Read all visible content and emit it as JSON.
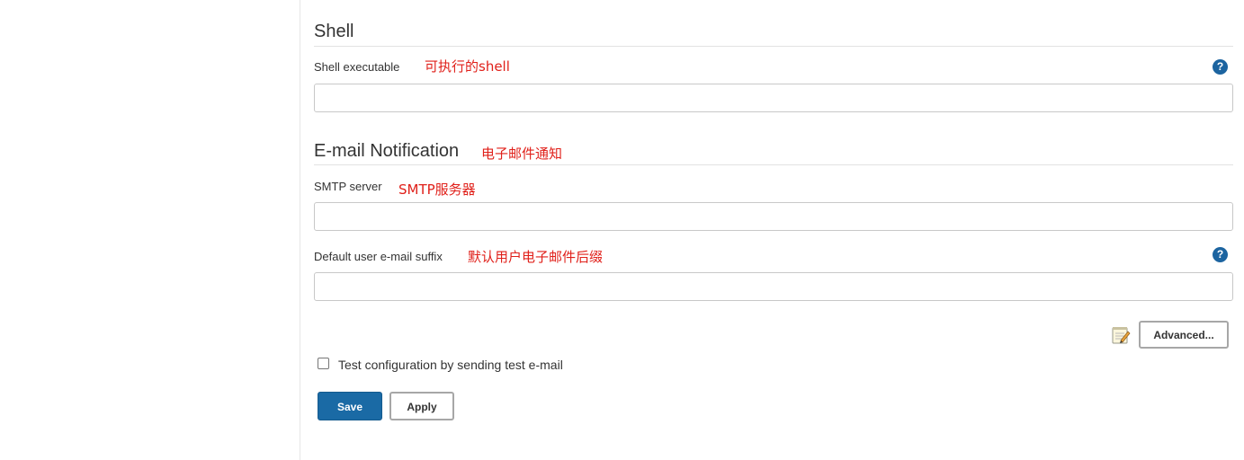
{
  "shell": {
    "title": "Shell",
    "executable_label": "Shell executable",
    "executable_annotation": "可执行的shell",
    "executable_value": ""
  },
  "email": {
    "title": "E-mail Notification",
    "title_annotation": "电子邮件通知",
    "smtp_label": "SMTP server",
    "smtp_annotation": "SMTP服务器",
    "smtp_value": "",
    "suffix_label": "Default user e-mail suffix",
    "suffix_annotation": "默认用户电子邮件后缀",
    "suffix_value": "",
    "advanced_label": "Advanced...",
    "test_label": "Test configuration by sending test e-mail"
  },
  "actions": {
    "save_label": "Save",
    "apply_label": "Apply"
  },
  "icons": {
    "help": "help-icon",
    "notepad": "notepad-icon",
    "help_glyph": "?"
  },
  "colors": {
    "annotation": "#e0201a",
    "primary_button": "#1a6aa5",
    "help_icon": "#1c64a0"
  }
}
